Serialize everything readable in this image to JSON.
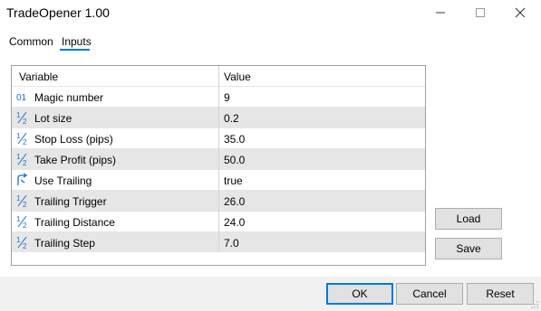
{
  "window": {
    "title": "TradeOpener 1.00",
    "controls": {
      "minimize": "—",
      "maximize": "☐",
      "close": "✕"
    }
  },
  "tabs": [
    {
      "label": "Common",
      "active": false
    },
    {
      "label": "Inputs",
      "active": true
    }
  ],
  "grid": {
    "headers": {
      "variable": "Variable",
      "value": "Value"
    },
    "rows": [
      {
        "icon": "int-icon",
        "name": "Magic number",
        "value": "9"
      },
      {
        "icon": "fraction-icon",
        "name": "Lot size",
        "value": "0.2"
      },
      {
        "icon": "fraction-icon",
        "name": "Stop Loss (pips)",
        "value": "35.0"
      },
      {
        "icon": "fraction-icon",
        "name": "Take Profit (pips)",
        "value": "50.0"
      },
      {
        "icon": "bool-icon",
        "name": "Use Trailing",
        "value": "true"
      },
      {
        "icon": "fraction-icon",
        "name": "Trailing Trigger",
        "value": "26.0"
      },
      {
        "icon": "fraction-icon",
        "name": "Trailing Distance",
        "value": "24.0"
      },
      {
        "icon": "fraction-icon",
        "name": "Trailing Step",
        "value": "7.0"
      }
    ]
  },
  "side_buttons": {
    "load": "Load",
    "save": "Save"
  },
  "footer_buttons": {
    "ok": "OK",
    "cancel": "Cancel",
    "reset": "Reset"
  },
  "colors": {
    "accent": "#0078d7",
    "row_alt": "#e6e6e6",
    "icon_blue": "#1e6fc3"
  }
}
